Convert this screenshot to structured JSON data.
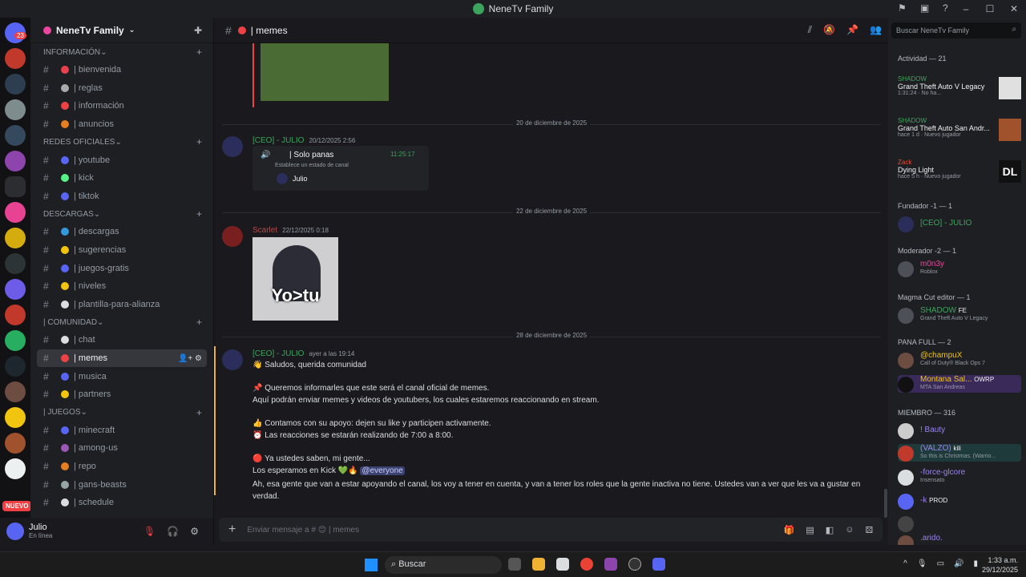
{
  "window": {
    "title": "NeneTv Family"
  },
  "guilds": {
    "badge": "23",
    "nuevo": "NUEVO"
  },
  "server": {
    "name": "NeneTv Family"
  },
  "categories": [
    {
      "label": "INFORMACIÓN",
      "channels": [
        {
          "name": "| bienvenida",
          "color": "#e8404c"
        },
        {
          "name": "| reglas",
          "color": "#aaa"
        },
        {
          "name": "| información",
          "color": "#ed4245"
        },
        {
          "name": "| anuncios",
          "color": "#e67e22"
        }
      ]
    },
    {
      "label": "REDES OFICIALES",
      "channels": [
        {
          "name": "| youtube",
          "color": "#5865f2"
        },
        {
          "name": "| kick",
          "color": "#57f287"
        },
        {
          "name": "| tiktok",
          "color": "#5865f2"
        }
      ]
    },
    {
      "label": "DESCARGAS",
      "channels": [
        {
          "name": "| descargas",
          "color": "#3498db"
        },
        {
          "name": "| sugerencias",
          "color": "#f1c40f"
        },
        {
          "name": "| juegos-gratis",
          "color": "#5865f2"
        },
        {
          "name": "| niveles",
          "color": "#f1c40f"
        },
        {
          "name": "| plantilla-para-alianza",
          "color": "#dbdee1"
        }
      ]
    },
    {
      "label": "| COMUNIDAD",
      "channels": [
        {
          "name": "| chat",
          "color": "#dbdee1"
        },
        {
          "name": "| memes",
          "color": "#ed4245",
          "active": true
        },
        {
          "name": "| musica",
          "color": "#5865f2"
        },
        {
          "name": "| partners",
          "color": "#f1c40f"
        }
      ]
    },
    {
      "label": "| JUEGOS",
      "channels": [
        {
          "name": "| minecraft",
          "color": "#5865f2"
        },
        {
          "name": "| among-us",
          "color": "#9b59b6"
        },
        {
          "name": "| repo",
          "color": "#e67e22"
        },
        {
          "name": "| gans-beasts",
          "color": "#95a5a6"
        },
        {
          "name": "| schedule",
          "color": "#dbdee1"
        }
      ]
    }
  ],
  "user": {
    "name": "Julio",
    "status": "En línea"
  },
  "channel": {
    "name": "memes"
  },
  "messages": {
    "div1": "20 de diciembre de 2025",
    "div2": "22 de diciembre de 2025",
    "div3": "28 de diciembre de 2025",
    "m1": {
      "author": "[CEO] - JULIO",
      "time": "20/12/2025 2:56",
      "voice": "| Solo panas",
      "voice_time": "11:25:17",
      "voice_sub": "Establece un estado de canal",
      "voice_user": "Julio"
    },
    "m2": {
      "author": "Scarlet",
      "time": "22/12/2025 0:18",
      "image_text": "Yo>tu"
    },
    "m3": {
      "author": "[CEO] - JULIO",
      "time": "ayer a las 19:14",
      "l1": "Saludos, querida comunidad",
      "l2": "Queremos informarles que este será el canal oficial de memes.",
      "l3": "Aquí podrán enviar memes y videos de youtubers, los cuales estaremos reaccionando en stream.",
      "l4": "Contamos con su apoyo: dejen su like y participen activamente.",
      "l5": "Las reacciones se estarán realizando de 7:00 a 8:00.",
      "l6": "Ya ustedes saben, mi gente...",
      "l7": "Los esperamos en Kick",
      "mention": "@everyone",
      "l8": "Ah, esa gente que van a estar apoyando el canal, los voy a tener en cuenta, y van a tener los roles que la gente inactiva no tiene. Ustedes van a ver que les va a gustar en",
      "l9": "verdad."
    }
  },
  "input": {
    "placeholder": "Enviar mensaje a #",
    "suffix": "| memes"
  },
  "right": {
    "search": "Buscar NeneTv Family",
    "activity_label": "Actividad — 21",
    "activities": [
      {
        "user": "SHADOW",
        "game": "Grand Theft Auto V Legacy",
        "sub": "1:31:24 · No ha..."
      },
      {
        "user": "SHADOW",
        "game": "Grand Theft Auto San Andr...",
        "sub": "hace 1 d · Nuevo jugador"
      },
      {
        "user": "Zack",
        "game": "Dying Light",
        "sub": "hace 5 h · Nuevo jugador"
      }
    ],
    "fundador": "Fundador -1 — 1",
    "fundador_member": "[CEO] - JULIO",
    "moderador": "Moderador -2 — 1",
    "mod_member": "m0n3y",
    "mod_sub": "Roblox",
    "magma": "Magma Cut editor — 1",
    "magma_member": "SHADOW",
    "magma_tag": "FE",
    "magma_sub": "Grand Theft Auto V Legacy",
    "pana": "PANA FULL — 2",
    "pana1": "@champuX",
    "pana1_sub": "Call of Duty® Black Ops 7",
    "pana2": "Montana Sal...",
    "pana2_tag": "OWRP",
    "pana2_sub": "MTA San Andreas",
    "miembro": "MIEMBRO — 316",
    "mb1": "! Bauty",
    "mb2": "(VALZO)",
    "mb2_tag": "kili",
    "mb2_sub": "So this is Christmas. (Warrio...",
    "mb3": "-force-glcore",
    "mb3_sub": "Insensato",
    "mb4": "-k",
    "mb4_tag": "PROD",
    "mb6": ".arido."
  },
  "taskbar": {
    "search": "Buscar",
    "time": "1:33 a.m.",
    "date": "29/12/2025"
  }
}
